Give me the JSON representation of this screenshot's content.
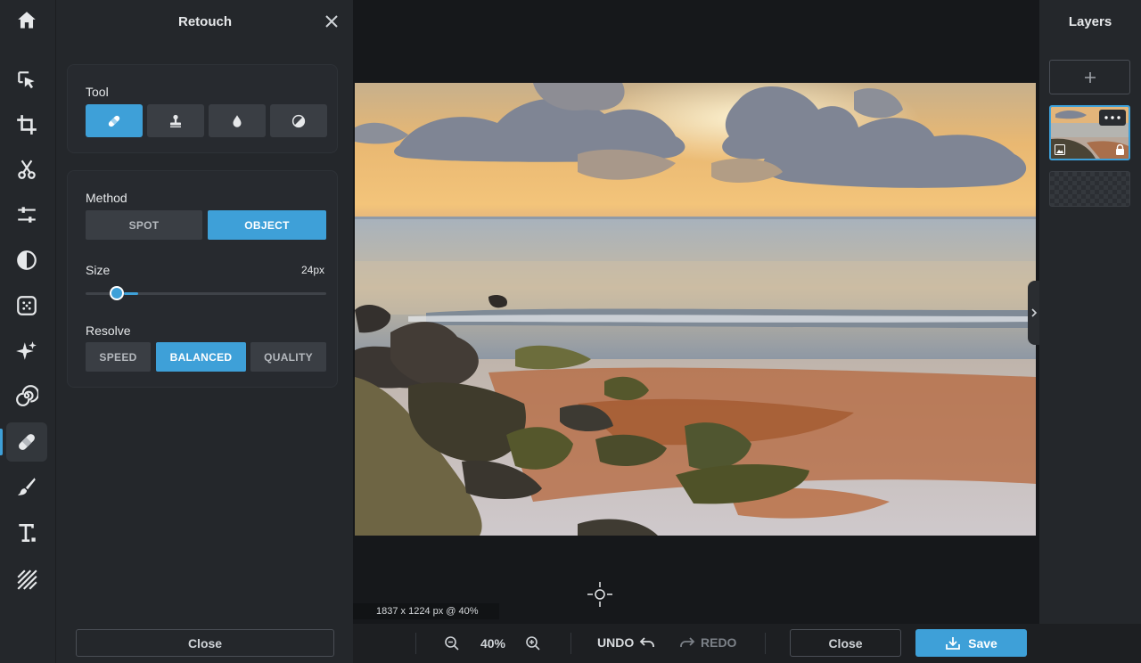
{
  "panel": {
    "title": "Retouch",
    "tool_label": "Tool",
    "tools": [
      {
        "icon": "bandage-icon",
        "active": true
      },
      {
        "icon": "stamp-icon",
        "active": false
      },
      {
        "icon": "drop-icon",
        "active": false
      },
      {
        "icon": "contrast-circle-icon",
        "active": false
      }
    ],
    "method_label": "Method",
    "methods": [
      "SPOT",
      "OBJECT"
    ],
    "method_selected": "OBJECT",
    "size_label": "Size",
    "size_value": "24px",
    "size_fraction": 0.13,
    "resolve_label": "Resolve",
    "resolve_options": [
      "SPEED",
      "BALANCED",
      "QUALITY"
    ],
    "resolve_selected": "BALANCED",
    "close_label": "Close"
  },
  "rail": {
    "items": [
      "home-icon",
      "select-arrow-icon",
      "crop-icon",
      "scissors-icon",
      "sliders-icon",
      "contrast-icon",
      "texture-icon",
      "sparkle-icon",
      "spiral-icon",
      "bandage-icon",
      "brush-icon",
      "text-icon",
      "diagonal-lines-icon"
    ],
    "active": "bandage-icon"
  },
  "canvas": {
    "size_readout": "1837 x 1224 px @ 40%"
  },
  "bottom_bar": {
    "zoom_value": "40%",
    "undo_label": "UNDO",
    "redo_label": "REDO",
    "close_label": "Close",
    "save_label": "Save"
  },
  "layers": {
    "title": "Layers"
  },
  "colors": {
    "accent": "#3ea0d8",
    "panel_bg": "#24272b",
    "canvas_bg": "#16181b"
  }
}
